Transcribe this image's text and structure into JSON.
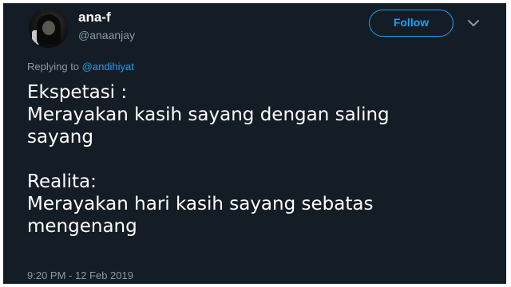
{
  "user": {
    "display_name": "ana-f",
    "handle": "@anaanjay",
    "avatar_icon": "profile-photo"
  },
  "header": {
    "follow_label": "Follow",
    "menu_icon": "chevron-down-icon"
  },
  "reply": {
    "prefix": "Replying to ",
    "mention": "@andihiyat"
  },
  "tweet": {
    "text": "Ekspetasi :\nMerayakan kasih sayang dengan saling\nsayang\n\nRealita:\nMerayakan hari kasih sayang sebatas\nmengenang",
    "timestamp": "9:20 PM - 12 Feb 2019"
  },
  "colors": {
    "background": "#141d26",
    "accent": "#1da1f2",
    "muted": "#8899a6",
    "text": "#ffffff"
  }
}
